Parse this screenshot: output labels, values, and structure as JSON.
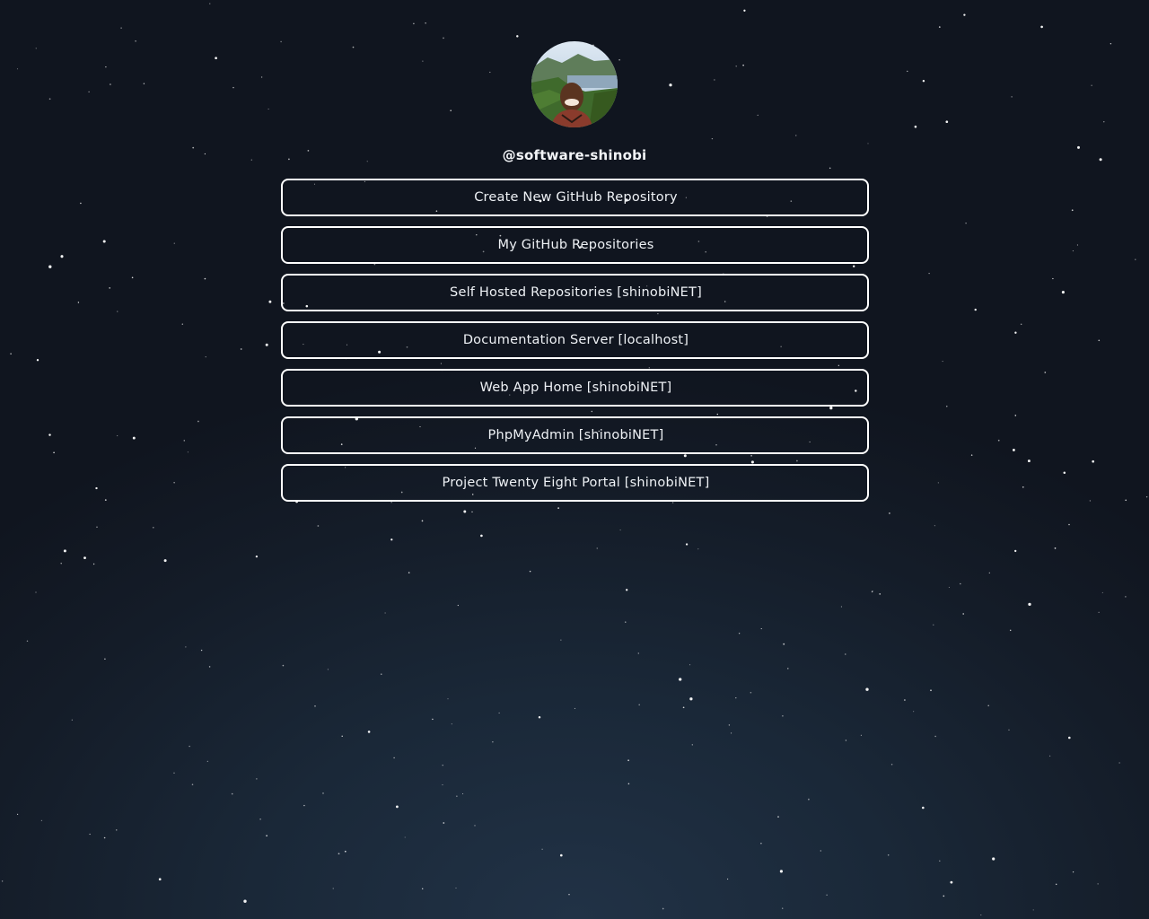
{
  "profile": {
    "avatar_icon": "profile-photo",
    "username": "@software-shinobi"
  },
  "links": [
    {
      "label": "Create New GitHub Repository"
    },
    {
      "label": "My GitHub Repositories"
    },
    {
      "label": "Self Hosted Repositories [shinobiNET]"
    },
    {
      "label": "Documentation Server [localhost]"
    },
    {
      "label": "Web App Home [shinobiNET]"
    },
    {
      "label": "PhpMyAdmin [shinobiNET]"
    },
    {
      "label": "Project Twenty Eight Portal [shinobiNET]"
    }
  ],
  "colors": {
    "background_top": "#10151f",
    "background_bottom": "#213246",
    "button_border": "#ffffff",
    "text": "#eef1f5"
  }
}
